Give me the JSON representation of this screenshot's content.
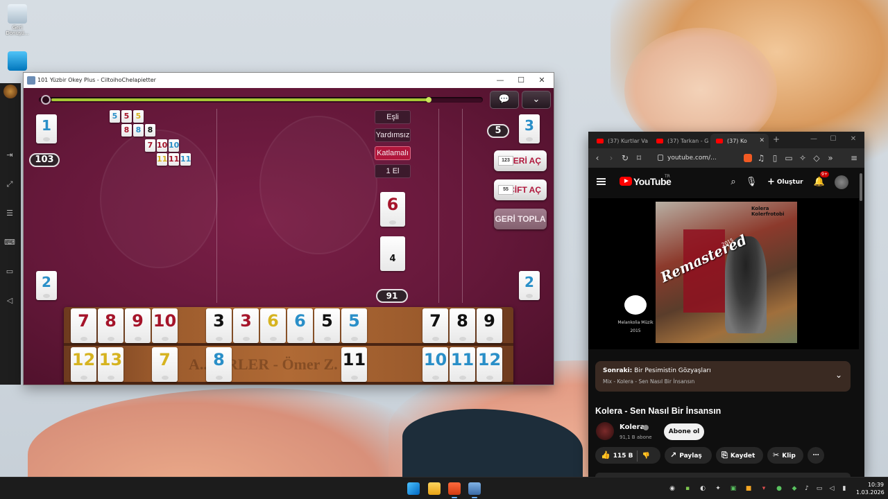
{
  "desktop": {
    "icons": [
      {
        "label": "Geri Dönüşü..."
      },
      {
        "label": ""
      }
    ]
  },
  "game_window": {
    "title": "101 Yüzbir Okey Plus - CiltoihoChelapietter",
    "controls": {
      "minimize": "—",
      "maximize": "☐",
      "close": "✕"
    },
    "timer_progress": 0.88,
    "top_buttons": {
      "chat": "💬",
      "menu": "⌄"
    },
    "players": {
      "left_top": {
        "tile": "1",
        "score": "103"
      },
      "left_bottom": {
        "tile": "2"
      },
      "right_top": {
        "tile": "3",
        "count": "5"
      },
      "right_bottom": {
        "tile": "2"
      }
    },
    "melds": [
      [
        {
          "v": "5",
          "c": "blue"
        },
        {
          "v": "5",
          "c": "red"
        },
        {
          "v": "5",
          "c": "yellow"
        }
      ],
      [
        {
          "v": "8",
          "c": "red"
        },
        {
          "v": "8",
          "c": "blue"
        },
        {
          "v": "8",
          "c": "black"
        }
      ],
      [
        {
          "v": "7",
          "c": "red"
        },
        {
          "v": "10",
          "c": "red"
        },
        {
          "v": "10",
          "c": "blue"
        }
      ],
      [
        {
          "v": "11",
          "c": "yellow"
        },
        {
          "v": "11",
          "c": "red"
        },
        {
          "v": "11",
          "c": "blue"
        }
      ]
    ],
    "modes": [
      {
        "label": "Eşli",
        "active": false
      },
      {
        "label": "Yardımsız",
        "active": false
      },
      {
        "label": "Katlamalı",
        "active": true
      },
      {
        "label": "1 El",
        "active": false
      }
    ],
    "indicator_tile": {
      "value": "6",
      "color": "red"
    },
    "pile_tile": {
      "value": "4"
    },
    "remaining": "91",
    "actions": {
      "seri_ac": "SERİ AÇ",
      "cift_ac": "ÇİFT AÇ",
      "geri_topla": "GERİ TOPLA"
    },
    "rack_engraving": "A... ÖRLER - Ömer Z.",
    "rack_top": [
      {
        "v": "7",
        "c": "red"
      },
      {
        "v": "8",
        "c": "red"
      },
      {
        "v": "9",
        "c": "red"
      },
      {
        "v": "10",
        "c": "red"
      },
      {
        "v": "3",
        "c": "black"
      },
      {
        "v": "3",
        "c": "red"
      },
      {
        "v": "6",
        "c": "yellow"
      },
      {
        "v": "6",
        "c": "blue"
      },
      {
        "v": "5",
        "c": "black"
      },
      {
        "v": "5",
        "c": "blue"
      },
      {
        "v": "7",
        "c": "black"
      },
      {
        "v": "8",
        "c": "black"
      },
      {
        "v": "9",
        "c": "black"
      }
    ],
    "rack_bottom": [
      {
        "v": "12",
        "c": "yellow"
      },
      {
        "v": "13",
        "c": "yellow"
      },
      {
        "v": "7",
        "c": "yellow"
      },
      {
        "v": "8",
        "c": "blue"
      },
      {
        "v": "11",
        "c": "black"
      },
      {
        "v": "10",
        "c": "blue"
      },
      {
        "v": "11",
        "c": "blue"
      },
      {
        "v": "12",
        "c": "blue"
      }
    ]
  },
  "browser": {
    "tabs": [
      {
        "label": "(37) Kurtlar Va",
        "active": false
      },
      {
        "label": "(37) Tarkan - G",
        "active": false
      },
      {
        "label": "(37) Ko",
        "active": true
      }
    ],
    "new_tab": "+",
    "url": "youtube.com/...",
    "youtube": {
      "logo": "YouTube",
      "country": "TR",
      "create_label": "Oluştur",
      "notification_count": "9+",
      "album": {
        "overlay": "Remastered",
        "year": "2015",
        "band": "Kolera Kolerfrotobi"
      },
      "label_name": "Melankolia Müzik",
      "label_year": "2015",
      "next_up": {
        "prefix": "Sonraki:",
        "title": "Bir Pesimistin Gözyaşları",
        "mix": "Mix - Kolera - Sen Nasıl Bir İnsansın"
      },
      "video_title": "Kolera - Sen Nasıl Bir İnsansın",
      "channel": {
        "name": "Kolera",
        "subscribers": "91,1 B abone"
      },
      "subscribe_label": "Abone ol",
      "likes": "115 B",
      "share_label": "Paylaş",
      "save_label": "Kaydet",
      "clip_label": "Klip"
    }
  },
  "taskbar": {
    "time": "10:39",
    "date": "1.03.2026"
  },
  "colors": {
    "tile_red": "#a5142a",
    "tile_blue": "#2a8fc8",
    "tile_black": "#111111",
    "tile_yellow": "#d6b320",
    "felt": "#6a1a3e",
    "yt_red": "#ff0000"
  }
}
